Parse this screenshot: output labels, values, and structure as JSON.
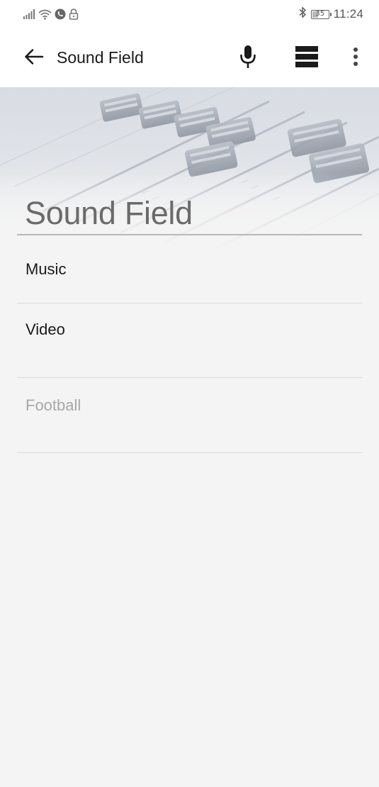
{
  "status_bar": {
    "time": "11:24",
    "battery_level": "35",
    "icons": [
      "signal-icon",
      "wifi-icon",
      "call-icon",
      "lock-icon",
      "bluetooth-icon",
      "battery-icon"
    ]
  },
  "toolbar": {
    "title": "Sound Field",
    "icons": [
      "back-arrow-icon",
      "microphone-icon",
      "layout-icon",
      "more-vert-icon"
    ]
  },
  "header": {
    "heading": "Sound Field"
  },
  "list": {
    "items": [
      {
        "label": "Music",
        "enabled": true
      },
      {
        "label": "Video",
        "enabled": true
      },
      {
        "label": "Football",
        "enabled": false
      }
    ]
  },
  "colors": {
    "background": "#f4f4f4",
    "toolbar": "#ffffff",
    "text_primary": "#1a1a1a",
    "text_disabled": "#a8a8a8",
    "heading": "#6b6b6b",
    "divider": "#d9d9d9"
  }
}
